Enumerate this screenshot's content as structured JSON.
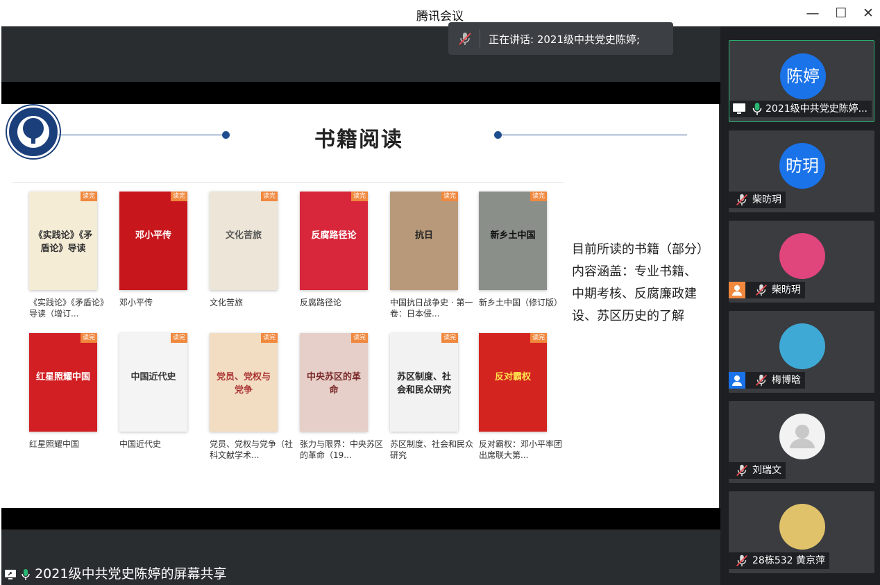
{
  "window": {
    "title": "腾讯会议",
    "controls": [
      "minimize",
      "maximize",
      "close"
    ]
  },
  "speaker_bar": {
    "text": "正在讲话: 2021级中共党史陈婷;"
  },
  "slide": {
    "title": "书籍阅读",
    "badge": "读完",
    "books": [
      {
        "title": "《实践论》《矛盾论》导读（增订...",
        "cover_text": "《实践论》《矛盾论》导读",
        "color": "#f5ecd6",
        "text_color": "#333"
      },
      {
        "title": "邓小平传",
        "cover_text": "邓小平传",
        "color": "#c8161d",
        "text_color": "#fff"
      },
      {
        "title": "文化苦旅",
        "cover_text": "文化苦旅",
        "color": "#ede6d8",
        "text_color": "#555"
      },
      {
        "title": "反腐路径论",
        "cover_text": "反腐路径论",
        "color": "#d8263a",
        "text_color": "#fff"
      },
      {
        "title": "中国抗日战争史 · 第一卷：日本侵...",
        "cover_text": "抗日",
        "color": "#b89a7a",
        "text_color": "#222"
      },
      {
        "title": "新乡土中国（修订版）",
        "cover_text": "新乡土中国",
        "color": "#8a8f8a",
        "text_color": "#111"
      },
      {
        "title": "红星照耀中国",
        "cover_text": "红星照耀中国",
        "color": "#d21f23",
        "text_color": "#fff"
      },
      {
        "title": "中国近代史",
        "cover_text": "中国近代史",
        "color": "#f4f4f4",
        "text_color": "#333"
      },
      {
        "title": "党员、党权与党争（社科文献学术...",
        "cover_text": "党员、党权与党争",
        "color": "#f3ddc2",
        "text_color": "#a33"
      },
      {
        "title": "张力与限界：中央苏区的革命（19...",
        "cover_text": "中央苏区的革命",
        "color": "#e6cfc8",
        "text_color": "#7a2a2a"
      },
      {
        "title": "苏区制度、社会和民众研究",
        "cover_text": "苏区制度、社会和民众研究",
        "color": "#f2f2f2",
        "text_color": "#222"
      },
      {
        "title": "反对霸权：邓小平率团出席联大第...",
        "cover_text": "反对霸权",
        "color": "#d4241f",
        "text_color": "#ffe14d"
      }
    ],
    "notes": [
      "目前所读的书籍（部分）",
      "内容涵盖：专业书籍、",
      "中期考核、反腐廉政建",
      "设、苏区历史的了解"
    ]
  },
  "share_bar": {
    "text": "2021级中共党史陈婷的屏幕共享"
  },
  "participants": [
    {
      "name": "2021级中共党史陈婷...",
      "avatar_text": "陈婷",
      "avatar_color": "#1a73e8",
      "active": true,
      "sharing": true,
      "muted": false
    },
    {
      "name": "柴昉玥",
      "avatar_text": "昉玥",
      "avatar_color": "#1a73e8",
      "active": false,
      "muted": true
    },
    {
      "name": "柴昉玥",
      "avatar_text": "",
      "avatar_color": "#e0457b",
      "active": false,
      "muted": true,
      "badge": "orange"
    },
    {
      "name": "梅博晗",
      "avatar_text": "",
      "avatar_color": "#3fa9d6",
      "active": false,
      "muted": true,
      "badge": "blue"
    },
    {
      "name": "刘瑞文",
      "avatar_text": "",
      "avatar_color": "#f2f2f2",
      "active": false,
      "muted": true
    },
    {
      "name": "28栋532 黄京萍",
      "avatar_text": "",
      "avatar_color": "#e0c26a",
      "active": false,
      "muted": true
    }
  ]
}
